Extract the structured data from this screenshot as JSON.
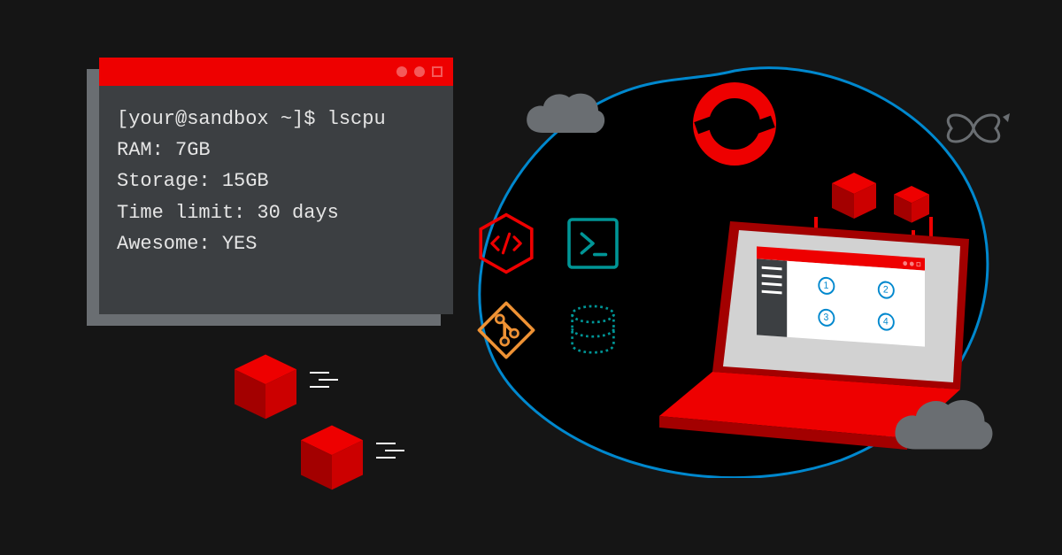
{
  "terminal": {
    "prompt": "[your@sandbox ~]$ lscpu",
    "lines": [
      "RAM: 7GB",
      "Storage: 15GB",
      "Time limit: 30 days",
      "Awesome: YES"
    ]
  },
  "laptop_screen": {
    "numbers": [
      "1",
      "2",
      "3",
      "4"
    ]
  },
  "colors": {
    "bg": "#151515",
    "red": "#ee0000",
    "dark_red": "#a30000",
    "terminal_bg": "#3c3f42",
    "terminal_shadow": "#6a6e72",
    "grey": "#6a6e72",
    "teal": "#009596",
    "orange": "#ef9234",
    "blue_outline": "#0088ce"
  },
  "icons": {
    "top_left": "code",
    "top_right": "terminal-prompt",
    "bottom_left": "git",
    "bottom_right": "database"
  }
}
